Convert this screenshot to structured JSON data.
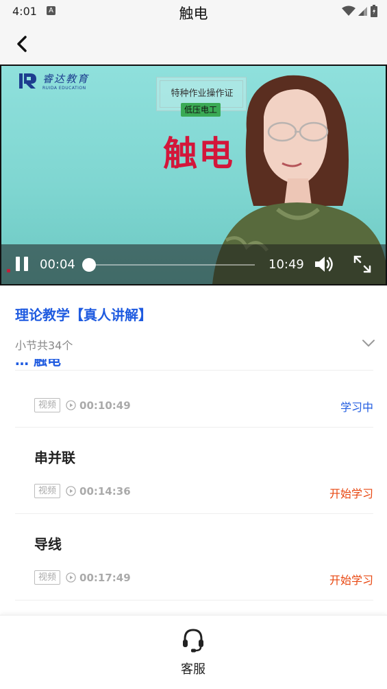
{
  "status_bar": {
    "time": "4:01",
    "notification_badge": "A"
  },
  "header": {
    "title": "触电"
  },
  "video": {
    "logo_cn": "睿达教育",
    "logo_en": "RUIDA EDUCATION",
    "cert_text": "特种作业操作证",
    "cert_tag": "低压电工",
    "big_title": "触电",
    "current_time": "00:04",
    "total_time": "10:49",
    "progress_fraction": 0.006
  },
  "course": {
    "title": "理论教学【真人讲解】",
    "section_count": "小节共34个",
    "partial_item_title": "… 触电"
  },
  "lessons": [
    {
      "name": "触电",
      "tag": "视频",
      "duration": "00:10:49",
      "status": "学习中",
      "status_color": "#1f5be0"
    },
    {
      "name": "串并联",
      "tag": "视频",
      "duration": "00:14:36",
      "status": "开始学习",
      "status_color": "#e8460f"
    },
    {
      "name": "导线",
      "tag": "视频",
      "duration": "00:17:49",
      "status": "开始学习",
      "status_color": "#e8460f"
    }
  ],
  "bottom_bar": {
    "service_label": "客服"
  },
  "colors": {
    "accent_blue": "#1f5be0",
    "accent_orange": "#e8460f",
    "title_red": "#d3163a"
  }
}
